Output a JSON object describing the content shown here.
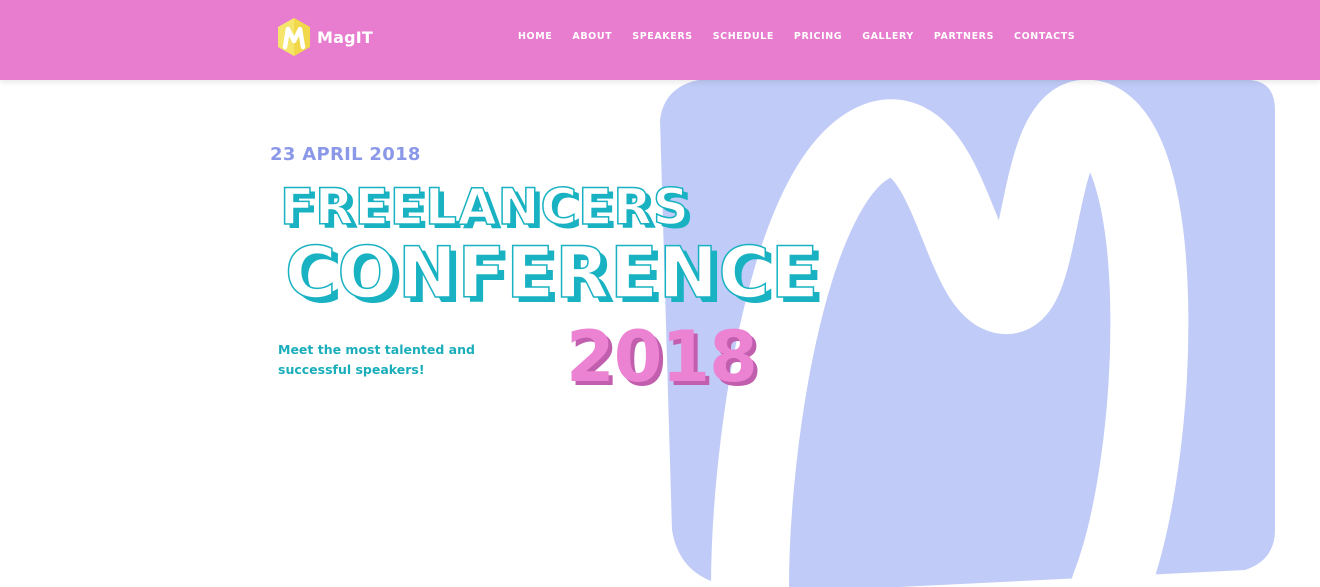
{
  "header": {
    "logo_text": "MagIT",
    "logo_icon": "magit-hexagon-m-icon",
    "nav": [
      "HOME",
      "ABOUT",
      "SPEAKERS",
      "SCHEDULE",
      "PRICING",
      "GALLERY",
      "PARTNERS",
      "CONTACTS"
    ]
  },
  "hero": {
    "date": "23 APRIL 2018",
    "title_line1": "FREELANCERS",
    "title_line2": "CONFERENCE",
    "year": "2018",
    "tagline": "Meet the most talented and successful speakers!",
    "background_icon": "large-m-hexagon-icon"
  },
  "colors": {
    "header_bg": "#e87dcf",
    "accent_teal": "#19b2c2",
    "accent_pink": "#ec82d2",
    "date_color": "#8b98e8",
    "hexagon_bg": "#c0cbf7",
    "logo_yellow": "#f5e66b"
  }
}
